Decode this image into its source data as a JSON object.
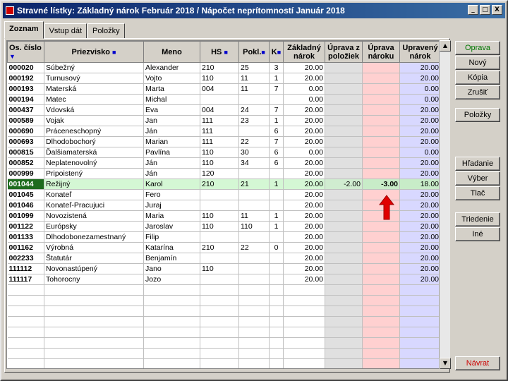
{
  "window": {
    "title": "Stravné lístky:  Základný nárok Február 2018  /  Nápočet neprítomností Január 2018",
    "min_glyph": "_",
    "max_glyph": "□",
    "close_glyph": "X"
  },
  "tabs": [
    {
      "label": "Zoznam",
      "active": true
    },
    {
      "label": "Vstup dát",
      "active": false
    },
    {
      "label": "Položky",
      "active": false
    }
  ],
  "columns": {
    "os_cislo": "Os. číslo",
    "priezvisko": "Priezvisko",
    "meno": "Meno",
    "hs": "HS",
    "pokl": "Pokl.",
    "k": "K",
    "zakladny_narok": "Základný nárok",
    "uprava_z_poloziek": "Úprava z položiek",
    "uprava_naroku": "Úprava nároku",
    "upraveny_narok": "Upravený nárok"
  },
  "rows": [
    {
      "os": "000020",
      "priezvisko": "Súbežný",
      "meno": "Alexander",
      "hs": "210",
      "pokl": "25",
      "k": "3",
      "zakl": "20.00",
      "upol": "",
      "unar": "",
      "upr": "20.00"
    },
    {
      "os": "000192",
      "priezvisko": "Turnusový",
      "meno": "Vojto",
      "hs": "110",
      "pokl": "11",
      "k": "1",
      "zakl": "20.00",
      "upol": "",
      "unar": "",
      "upr": "20.00"
    },
    {
      "os": "000193",
      "priezvisko": "Materská",
      "meno": "Marta",
      "hs": "004",
      "pokl": "11",
      "k": "7",
      "zakl": "0.00",
      "upol": "",
      "unar": "",
      "upr": "0.00"
    },
    {
      "os": "000194",
      "priezvisko": "Matec",
      "meno": "Michal",
      "hs": "",
      "pokl": "",
      "k": "",
      "zakl": "0.00",
      "upol": "",
      "unar": "",
      "upr": "0.00"
    },
    {
      "os": "000437",
      "priezvisko": "Vdovská",
      "meno": "Eva",
      "hs": "004",
      "pokl": "24",
      "k": "7",
      "zakl": "20.00",
      "upol": "",
      "unar": "",
      "upr": "20.00"
    },
    {
      "os": "000589",
      "priezvisko": "Vojak",
      "meno": "Jan",
      "hs": "111",
      "pokl": "23",
      "k": "1",
      "zakl": "20.00",
      "upol": "",
      "unar": "",
      "upr": "20.00"
    },
    {
      "os": "000690",
      "priezvisko": "Práceneschopný",
      "meno": "Ján",
      "hs": "111",
      "pokl": "",
      "k": "6",
      "zakl": "20.00",
      "upol": "",
      "unar": "",
      "upr": "20.00"
    },
    {
      "os": "000693",
      "priezvisko": "Dlhodobochorý",
      "meno": "Marian",
      "hs": "111",
      "pokl": "22",
      "k": "7",
      "zakl": "20.00",
      "upol": "",
      "unar": "",
      "upr": "20.00"
    },
    {
      "os": "000815",
      "priezvisko": "Ďalšiamaterská",
      "meno": "Pavlína",
      "hs": "110",
      "pokl": "30",
      "k": "6",
      "zakl": "0.00",
      "upol": "",
      "unar": "",
      "upr": "0.00"
    },
    {
      "os": "000852",
      "priezvisko": "Neplatenovolný",
      "meno": "Ján",
      "hs": "110",
      "pokl": "34",
      "k": "6",
      "zakl": "20.00",
      "upol": "",
      "unar": "",
      "upr": "20.00"
    },
    {
      "os": "000999",
      "priezvisko": "Pripoistený",
      "meno": "Ján",
      "hs": "120",
      "pokl": "",
      "k": "",
      "zakl": "20.00",
      "upol": "",
      "unar": "",
      "upr": "20.00"
    },
    {
      "os": "001044",
      "priezvisko": "Režijný",
      "meno": "Karol",
      "hs": "210",
      "pokl": "21",
      "k": "1",
      "zakl": "20.00",
      "upol": "-2.00",
      "unar": "-3.00",
      "upr": "18.00",
      "selected": true
    },
    {
      "os": "001045",
      "priezvisko": "Konateľ",
      "meno": "Fero",
      "hs": "",
      "pokl": "",
      "k": "",
      "zakl": "20.00",
      "upol": "",
      "unar": "",
      "upr": "20.00"
    },
    {
      "os": "001046",
      "priezvisko": "Konateľ-Pracujuci",
      "meno": "Juraj",
      "hs": "",
      "pokl": "",
      "k": "",
      "zakl": "20.00",
      "upol": "",
      "unar": "",
      "upr": "20.00"
    },
    {
      "os": "001099",
      "priezvisko": "Novozistená",
      "meno": "Maria",
      "hs": "110",
      "pokl": "11",
      "k": "1",
      "zakl": "20.00",
      "upol": "",
      "unar": "",
      "upr": "20.00"
    },
    {
      "os": "001122",
      "priezvisko": "Európsky",
      "meno": "Jaroslav",
      "hs": "110",
      "pokl": "110",
      "k": "1",
      "zakl": "20.00",
      "upol": "",
      "unar": "",
      "upr": "20.00"
    },
    {
      "os": "001133",
      "priezvisko": "Dlhodobonezamestnaný",
      "meno": "Filip",
      "hs": "",
      "pokl": "",
      "k": "",
      "zakl": "20.00",
      "upol": "",
      "unar": "",
      "upr": "20.00"
    },
    {
      "os": "001162",
      "priezvisko": "Výrobná",
      "meno": "Katarína",
      "hs": "210",
      "pokl": "22",
      "k": "0",
      "zakl": "20.00",
      "upol": "",
      "unar": "",
      "upr": "20.00"
    },
    {
      "os": "002233",
      "priezvisko": "Štatutár",
      "meno": "Benjamín",
      "hs": "",
      "pokl": "",
      "k": "",
      "zakl": "20.00",
      "upol": "",
      "unar": "",
      "upr": "20.00"
    },
    {
      "os": "111112",
      "priezvisko": "Novonastúpený",
      "meno": "Jano",
      "hs": "110",
      "pokl": "",
      "k": "",
      "zakl": "20.00",
      "upol": "",
      "unar": "",
      "upr": "20.00"
    },
    {
      "os": "111117",
      "priezvisko": "Tohorocny",
      "meno": "Jozo",
      "hs": "",
      "pokl": "",
      "k": "",
      "zakl": "20.00",
      "upol": "",
      "unar": "",
      "upr": "20.00"
    }
  ],
  "empty_rows": 8,
  "buttons": {
    "oprava": "Oprava",
    "novy": "Nový",
    "kopia": "Kópia",
    "zrusit": "Zrušiť",
    "polozky": "Položky",
    "hladanie": "Hľadanie",
    "vyber": "Výber",
    "tlac": "Tlač",
    "triedenie": "Triedenie",
    "ine": "Iné",
    "navrat": "Návrat"
  },
  "scroll": {
    "up_glyph": "▲",
    "down_glyph": "▼"
  },
  "colors": {
    "uprava_z_poloziek_bg": "#e0e0e0",
    "uprava_naroku_bg": "#ffd0d0",
    "upraveny_narok_bg": "#d8d8ff",
    "selected_row_bg": "#d4f7d4",
    "oprava_text": "#007700",
    "navrat_text": "#cc0000",
    "arrow": "#e00000"
  }
}
